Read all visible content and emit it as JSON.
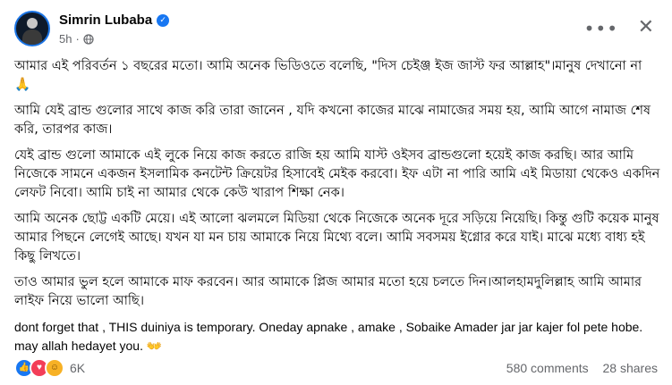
{
  "post": {
    "author": "Simrin Lubaba",
    "time": "5h",
    "paragraphs": [
      "আমার এই পরিবর্তন ১ বছরের মতো। আমি অনেক ভিডিওতে বলেছি, \"দিস চেইঞ্জ ইজ জাস্ট ফর আল্লাহ\"।মানুষ দেখানো না 🙏",
      "আমি যেই ব্রান্ড গুলোর সাথে কাজ করি তারা জানেন , যদি কখনো কাজের মাঝে নামাজের সময় হয়, আমি আগে নামাজ শেষ করি, তারপর কাজ।",
      "যেই ব্রান্ড গুলো আমাকে এই লুকে নিয়ে কাজ করতে রাজি হয় আমি যাস্ট ওইসব ব্রান্ডগুলো হয়েই কাজ করছি। আর আমি নিজেকে সামনে একজন ইসলামিক কনটেন্ট ক্রিয়েটর হিসাবেই মেইক করবো। ইফ এটা না পারি আমি এই মিডায়া থেকেও একদিন লেফট নিবো। আমি চাই না আমার থেকে কেউ খারাপ শিক্ষা নেক।",
      "আমি অনেক ছোট্ট একটি মেয়ে। এই আলো ঝলমলে মিডিয়া থেকে নিজেকে অনেক দূরে সড়িয়ে নিয়েছি। কিন্তু গুটি কয়েক মানুষ আমার পিছনে লেগেই আছে। যখন যা মন চায় আমাকে নিয়ে মিথ্যে বলে। আমি সবসময় ইগ্নোর করে যাই। মাঝে মধ্যে বাধ্য হই কিছু লিখতে।",
      "তাও আমার ভুল হলে আমাকে মাফ করবেন। আর আমাকে প্লিজ আমার মতো হয়ে চলতে দিন।আলহামদুলিল্লাহ আমি আমার লাইফ নিয়ে ভালো আছি।"
    ],
    "english_text": "dont forget that , THIS duiniya is temporary.  Oneday apnake , amake , Sobaike Amader jar jar kajer fol pete hobe. may allah hedayet you. 👐",
    "reaction_count": "6K",
    "comments": "580 comments",
    "shares": "28 shares"
  }
}
